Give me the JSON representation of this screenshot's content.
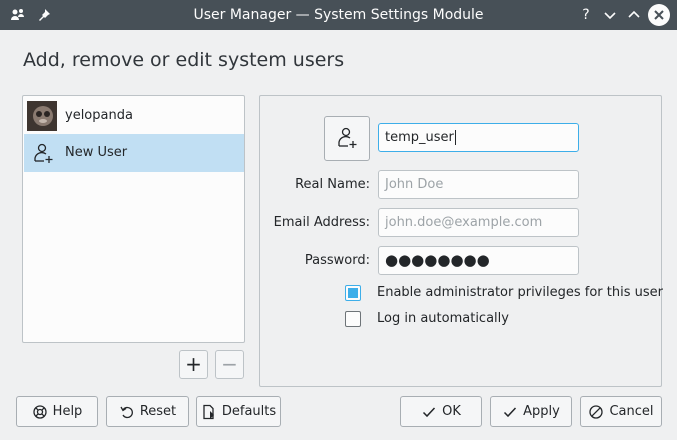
{
  "window": {
    "title": "User Manager — System Settings Module",
    "controls": [
      "help",
      "minimize",
      "maximize",
      "close"
    ]
  },
  "heading": "Add, remove or edit system users",
  "users": [
    {
      "label": "yelopanda",
      "icon": "user-avatar-photo",
      "selected": false
    },
    {
      "label": "New User",
      "icon": "user-add-icon",
      "selected": true
    }
  ],
  "list_buttons": {
    "add": "+",
    "remove": "−"
  },
  "form": {
    "username": "temp_user",
    "real_name": {
      "label": "Real Name:",
      "placeholder": "John Doe"
    },
    "email": {
      "label": "Email Address:",
      "placeholder": "john.doe@example.com"
    },
    "password": {
      "label": "Password:",
      "value": "●●●●●●●●"
    },
    "admin_checkbox": {
      "label": "Enable administrator privileges for this user",
      "checked": true
    },
    "autologin_checkbox": {
      "label": "Log in automatically",
      "checked": false
    }
  },
  "buttons": {
    "help": "Help",
    "reset": "Reset",
    "defaults": "Defaults",
    "ok": "OK",
    "apply": "Apply",
    "cancel": "Cancel"
  },
  "colors": {
    "accent": "#3daee9",
    "selection": "#c1dff3",
    "titlebar": "#475057"
  }
}
